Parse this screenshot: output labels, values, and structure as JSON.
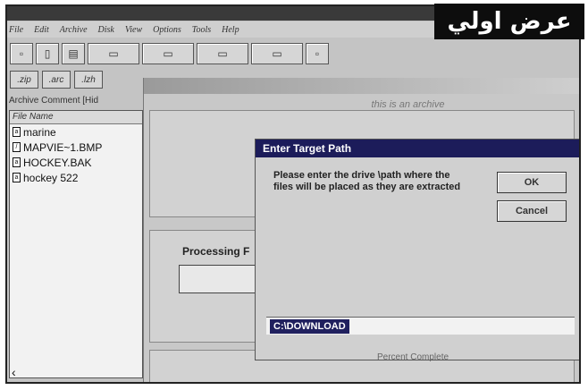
{
  "badge": {
    "text": "عرض اولي"
  },
  "menu": {
    "items": [
      "File",
      "Edit",
      "Archive",
      "Disk",
      "View",
      "Options",
      "Tools",
      "Help"
    ]
  },
  "toolbar2": {
    "items": [
      ".zip",
      ".arc",
      ".lzh"
    ]
  },
  "archive_comment": "Archive Comment [Hid",
  "file_list": {
    "header": "File Name",
    "files": [
      "marine",
      "MAPVIE~1.BMP",
      "HOCKEY.BAK",
      "hockey 522"
    ]
  },
  "background_window": {
    "subtitle": "this is an archive",
    "processing_label": "Processing F"
  },
  "dialog": {
    "title": "Enter Target Path",
    "message": "Please enter the drive \\path where the files will be placed as they are extracted",
    "ok_label": "OK",
    "cancel_label": "Cancel",
    "path_value": "C:\\DOWNLOAD",
    "percent_label": "Percent Complete"
  }
}
